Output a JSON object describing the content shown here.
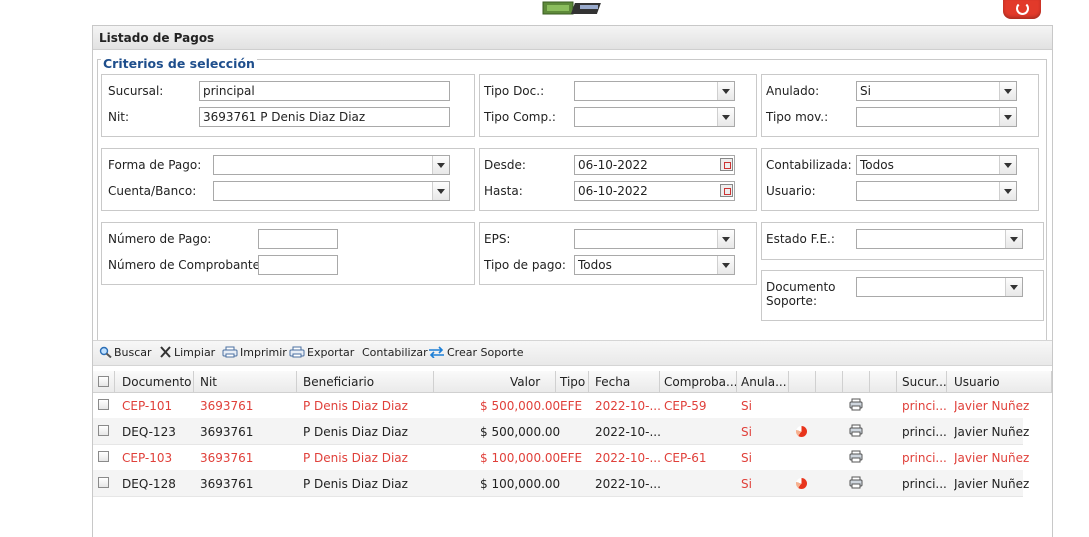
{
  "panel": {
    "title": "Listado de Pagos"
  },
  "criteria": {
    "legend": "Criterios de selección",
    "sucursal": {
      "label": "Sucursal:",
      "value": "principal"
    },
    "nit": {
      "label": "Nit:",
      "value": "3693761 P Denis Diaz Diaz"
    },
    "tipo_doc": {
      "label": "Tipo Doc.:",
      "value": ""
    },
    "tipo_comp": {
      "label": "Tipo Comp.:",
      "value": ""
    },
    "anulado": {
      "label": "Anulado:",
      "value": "Si"
    },
    "tipo_mov": {
      "label": "Tipo mov.:",
      "value": ""
    },
    "forma_pago": {
      "label": "Forma de Pago:",
      "value": ""
    },
    "cuenta_banco": {
      "label": "Cuenta/Banco:",
      "value": ""
    },
    "desde": {
      "label": "Desde:",
      "value": "06-10-2022"
    },
    "hasta": {
      "label": "Hasta:",
      "value": "06-10-2022"
    },
    "contabilizada": {
      "label": "Contabilizada:",
      "value": "Todos"
    },
    "usuario": {
      "label": "Usuario:",
      "value": ""
    },
    "numero_pago": {
      "label": "Número de Pago:",
      "value": ""
    },
    "numero_comprobante": {
      "label": "Número de Comprobante:",
      "value": ""
    },
    "eps": {
      "label": "EPS:",
      "value": ""
    },
    "tipo_pago": {
      "label": "Tipo de pago:",
      "value": "Todos"
    },
    "estado_fe": {
      "label": "Estado F.E.:",
      "value": ""
    },
    "documento_soporte": {
      "label_line1": "Documento",
      "label_line2": "Soporte:",
      "value": ""
    }
  },
  "toolbar": {
    "buscar": "Buscar",
    "limpiar": "Limpiar",
    "imprimir": "Imprimir",
    "exportar": "Exportar",
    "contabilizar": "Contabilizar",
    "crear_soporte": "Crear Soporte"
  },
  "grid": {
    "headers": {
      "documento": "Documento",
      "nit": "Nit",
      "beneficiario": "Beneficiario",
      "valor": "Valor",
      "tipo": "Tipo",
      "fecha": "Fecha",
      "comprobante": "Comproba...",
      "anulado": "Anula...",
      "sucursal": "Sucur...",
      "usuario": "Usuario"
    },
    "rows": [
      {
        "documento": "CEP-101",
        "nit": "3693761",
        "beneficiario": "P Denis Diaz Diaz",
        "valor": "$ 500,000.00",
        "tipo": "EFE",
        "fecha": "2022-10-...",
        "comprobante": "CEP-59",
        "anulado": "Si",
        "sucursal": "princi...",
        "usuario": "Javier Nuñez"
      },
      {
        "documento": "DEQ-123",
        "nit": "3693761",
        "beneficiario": "P Denis Diaz Diaz",
        "valor": "$ 500,000.00",
        "tipo": "",
        "fecha": "2022-10-...",
        "comprobante": "",
        "anulado": "Si",
        "sucursal": "princi...",
        "usuario": "Javier Nuñez"
      },
      {
        "documento": "CEP-103",
        "nit": "3693761",
        "beneficiario": "P Denis Diaz Diaz",
        "valor": "$ 100,000.00",
        "tipo": "EFE",
        "fecha": "2022-10-...",
        "comprobante": "CEP-61",
        "anulado": "Si",
        "sucursal": "princi...",
        "usuario": "Javier Nuñez"
      },
      {
        "documento": "DEQ-128",
        "nit": "3693761",
        "beneficiario": "P Denis Diaz Diaz",
        "valor": "$ 100,000.00",
        "tipo": "",
        "fecha": "2022-10-...",
        "comprobante": "",
        "anulado": "Si",
        "sucursal": "princi...",
        "usuario": "Javier Nuñez"
      }
    ]
  },
  "icons": {
    "top_left": "money-icon",
    "top_right": "power-icon",
    "row_status": "pie-status-icon",
    "row_print": "printer-icon"
  },
  "colors": {
    "accent": "#1e4e8c",
    "alert": "#e0403a",
    "power": "#e23a2a"
  }
}
